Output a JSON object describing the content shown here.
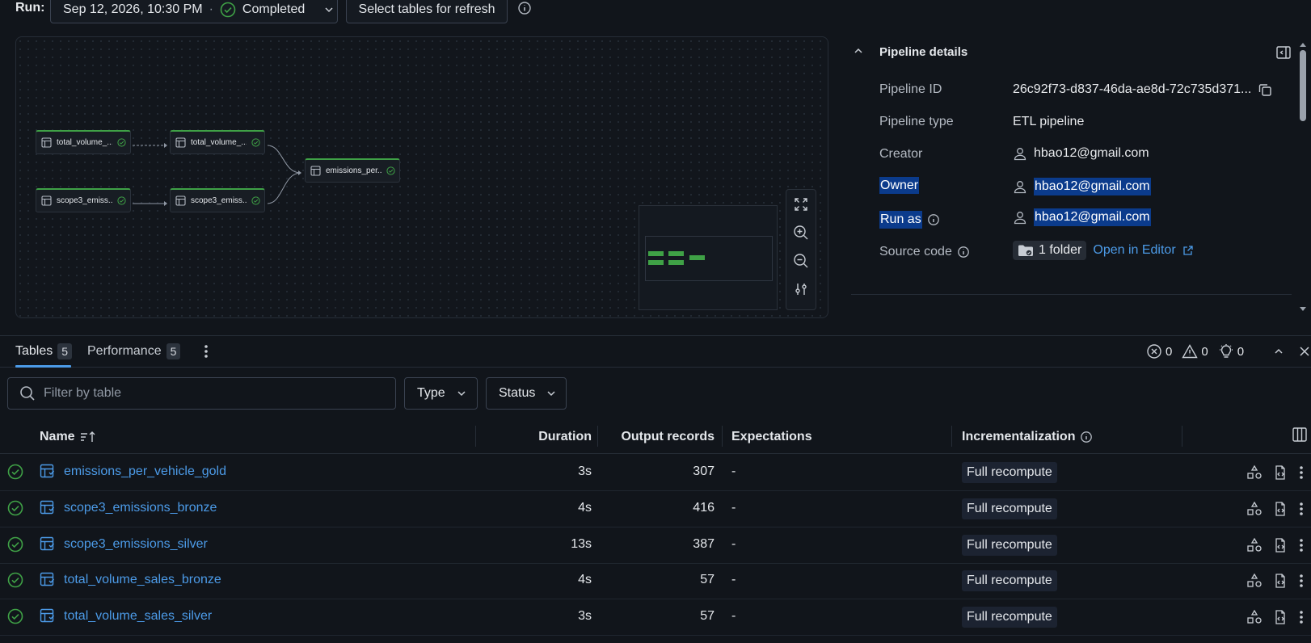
{
  "run": {
    "label": "Run:",
    "date": "Sep 12, 2026, 10:30 PM",
    "separator": "·",
    "status": "Completed",
    "refresh_label": "Select tables for refresh"
  },
  "graph": {
    "nodes": [
      {
        "label": "total_volume_..."
      },
      {
        "label": "total_volume_..."
      },
      {
        "label": "scope3_emiss..."
      },
      {
        "label": "scope3_emiss..."
      },
      {
        "label": "emissions_per..."
      }
    ]
  },
  "details": {
    "title": "Pipeline details",
    "pipeline_id_label": "Pipeline ID",
    "pipeline_id": "26c92f73-d837-46da-ae8d-72c735d371...",
    "pipeline_type_label": "Pipeline type",
    "pipeline_type": "ETL pipeline",
    "creator_label": "Creator",
    "creator": "hbao12@gmail.com",
    "owner_label": "Owner",
    "owner": "hbao12@gmail.com",
    "run_as_label": "Run as",
    "run_as": "hbao12@gmail.com",
    "source_code_label": "Source code",
    "folder": "1 folder",
    "open_editor": "Open in Editor"
  },
  "tabs": [
    {
      "label": "Tables",
      "count": "5"
    },
    {
      "label": "Performance",
      "count": "5"
    }
  ],
  "counters": {
    "errors": "0",
    "warnings": "0",
    "info": "0"
  },
  "filter": {
    "placeholder": "Filter by table",
    "type_label": "Type",
    "status_label": "Status"
  },
  "table": {
    "headers": {
      "name": "Name",
      "duration": "Duration",
      "output": "Output records",
      "expectations": "Expectations",
      "incremental": "Incrementalization"
    },
    "rows": [
      {
        "name": "emissions_per_vehicle_gold",
        "duration": "3s",
        "output": "307",
        "expectations": "-",
        "incremental": "Full recompute"
      },
      {
        "name": "scope3_emissions_bronze",
        "duration": "4s",
        "output": "416",
        "expectations": "-",
        "incremental": "Full recompute"
      },
      {
        "name": "scope3_emissions_silver",
        "duration": "13s",
        "output": "387",
        "expectations": "-",
        "incremental": "Full recompute"
      },
      {
        "name": "total_volume_sales_bronze",
        "duration": "4s",
        "output": "57",
        "expectations": "-",
        "incremental": "Full recompute"
      },
      {
        "name": "total_volume_sales_silver",
        "duration": "3s",
        "output": "57",
        "expectations": "-",
        "incremental": "Full recompute"
      }
    ]
  },
  "colors": {
    "accent": "#4c9be8",
    "success": "#3fa146",
    "highlight": "#0b3b8c"
  }
}
